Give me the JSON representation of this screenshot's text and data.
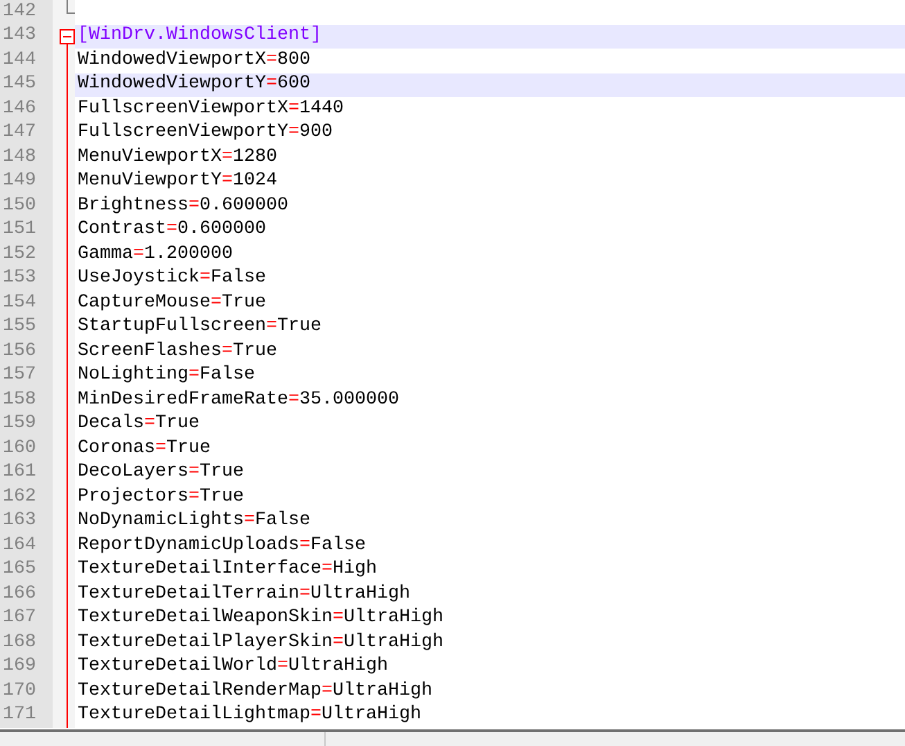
{
  "editor": {
    "lines": [
      {
        "number": "142",
        "kind": "fold_end",
        "highlighted": false
      },
      {
        "number": "143",
        "kind": "section",
        "text": "[WinDrv.WindowsClient]",
        "highlighted": true,
        "expanded": true
      },
      {
        "number": "144",
        "kind": "entry",
        "key": "WindowedViewportX",
        "equals": "=",
        "value": "800",
        "highlighted": false
      },
      {
        "number": "145",
        "kind": "entry",
        "key": "WindowedViewportY",
        "equals": "=",
        "value": "600",
        "highlighted": true
      },
      {
        "number": "146",
        "kind": "entry",
        "key": "FullscreenViewportX",
        "equals": "=",
        "value": "1440",
        "highlighted": false
      },
      {
        "number": "147",
        "kind": "entry",
        "key": "FullscreenViewportY",
        "equals": "=",
        "value": "900",
        "highlighted": false
      },
      {
        "number": "148",
        "kind": "entry",
        "key": "MenuViewportX",
        "equals": "=",
        "value": "1280",
        "highlighted": false
      },
      {
        "number": "149",
        "kind": "entry",
        "key": "MenuViewportY",
        "equals": "=",
        "value": "1024",
        "highlighted": false
      },
      {
        "number": "150",
        "kind": "entry",
        "key": "Brightness",
        "equals": "=",
        "value": "0.600000",
        "highlighted": false
      },
      {
        "number": "151",
        "kind": "entry",
        "key": "Contrast",
        "equals": "=",
        "value": "0.600000",
        "highlighted": false
      },
      {
        "number": "152",
        "kind": "entry",
        "key": "Gamma",
        "equals": "=",
        "value": "1.200000",
        "highlighted": false
      },
      {
        "number": "153",
        "kind": "entry",
        "key": "UseJoystick",
        "equals": "=",
        "value": "False",
        "highlighted": false
      },
      {
        "number": "154",
        "kind": "entry",
        "key": "CaptureMouse",
        "equals": "=",
        "value": "True",
        "highlighted": false
      },
      {
        "number": "155",
        "kind": "entry",
        "key": "StartupFullscreen",
        "equals": "=",
        "value": "True",
        "highlighted": false
      },
      {
        "number": "156",
        "kind": "entry",
        "key": "ScreenFlashes",
        "equals": "=",
        "value": "True",
        "highlighted": false
      },
      {
        "number": "157",
        "kind": "entry",
        "key": "NoLighting",
        "equals": "=",
        "value": "False",
        "highlighted": false
      },
      {
        "number": "158",
        "kind": "entry",
        "key": "MinDesiredFrameRate",
        "equals": "=",
        "value": "35.000000",
        "highlighted": false
      },
      {
        "number": "159",
        "kind": "entry",
        "key": "Decals",
        "equals": "=",
        "value": "True",
        "highlighted": false
      },
      {
        "number": "160",
        "kind": "entry",
        "key": "Coronas",
        "equals": "=",
        "value": "True",
        "highlighted": false
      },
      {
        "number": "161",
        "kind": "entry",
        "key": "DecoLayers",
        "equals": "=",
        "value": "True",
        "highlighted": false
      },
      {
        "number": "162",
        "kind": "entry",
        "key": "Projectors",
        "equals": "=",
        "value": "True",
        "highlighted": false
      },
      {
        "number": "163",
        "kind": "entry",
        "key": "NoDynamicLights",
        "equals": "=",
        "value": "False",
        "highlighted": false
      },
      {
        "number": "164",
        "kind": "entry",
        "key": "ReportDynamicUploads",
        "equals": "=",
        "value": "False",
        "highlighted": false
      },
      {
        "number": "165",
        "kind": "entry",
        "key": "TextureDetailInterface",
        "equals": "=",
        "value": "High",
        "highlighted": false
      },
      {
        "number": "166",
        "kind": "entry",
        "key": "TextureDetailTerrain",
        "equals": "=",
        "value": "UltraHigh",
        "highlighted": false
      },
      {
        "number": "167",
        "kind": "entry",
        "key": "TextureDetailWeaponSkin",
        "equals": "=",
        "value": "UltraHigh",
        "highlighted": false
      },
      {
        "number": "168",
        "kind": "entry",
        "key": "TextureDetailPlayerSkin",
        "equals": "=",
        "value": "UltraHigh",
        "highlighted": false
      },
      {
        "number": "169",
        "kind": "entry",
        "key": "TextureDetailWorld",
        "equals": "=",
        "value": "UltraHigh",
        "highlighted": false
      },
      {
        "number": "170",
        "kind": "entry",
        "key": "TextureDetailRenderMap",
        "equals": "=",
        "value": "UltraHigh",
        "highlighted": false
      },
      {
        "number": "171",
        "kind": "entry",
        "key": "TextureDetailLightmap",
        "equals": "=",
        "value": "UltraHigh",
        "highlighted": false
      }
    ]
  }
}
